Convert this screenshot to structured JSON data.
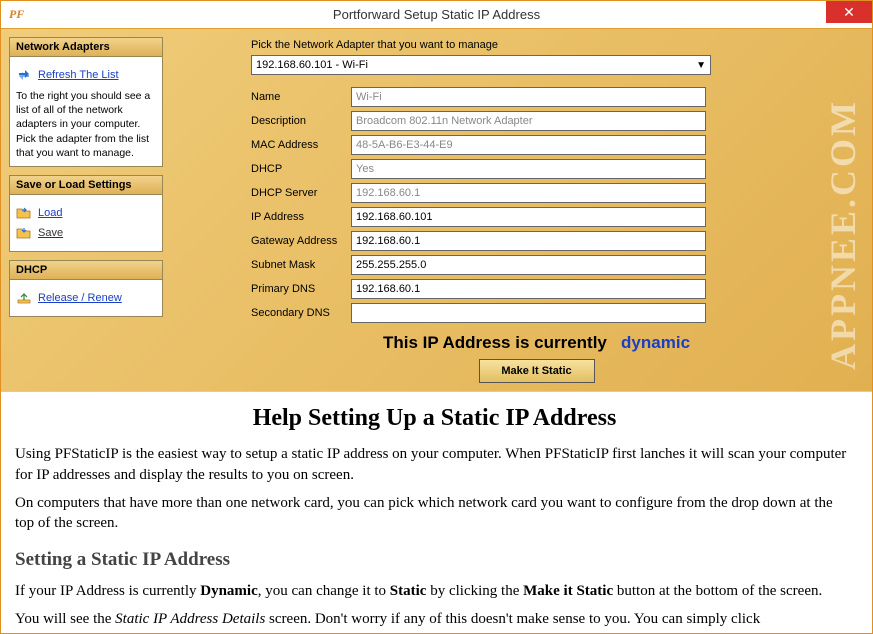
{
  "window": {
    "title": "Portforward Setup Static IP Address",
    "icon_label": "PF"
  },
  "sidebar": {
    "adapters": {
      "header": "Network Adapters",
      "refresh_link": "Refresh The List",
      "instructions": "To the right you should see a list of all of the network adapters in your computer. Pick the adapter from the list that you want to manage."
    },
    "saveload": {
      "header": "Save or Load Settings",
      "load_link": "Load",
      "save_link": "Save"
    },
    "dhcp": {
      "header": "DHCP",
      "release_link": "Release / Renew"
    }
  },
  "main": {
    "pick_label": "Pick the Network Adapter that you want to manage",
    "adapter_selected": "192.168.60.101 - Wi-Fi",
    "fields": {
      "name": {
        "label": "Name",
        "value": "Wi-Fi"
      },
      "description": {
        "label": "Description",
        "value": "Broadcom 802.11n Network Adapter"
      },
      "mac": {
        "label": "MAC Address",
        "value": "48-5A-B6-E3-44-E9"
      },
      "dhcp": {
        "label": "DHCP",
        "value": "Yes"
      },
      "dhcp_server": {
        "label": "DHCP Server",
        "value": "192.168.60.1"
      },
      "ip": {
        "label": "IP Address",
        "value": "192.168.60.101"
      },
      "gateway": {
        "label": "Gateway Address",
        "value": "192.168.60.1"
      },
      "subnet": {
        "label": "Subnet Mask",
        "value": "255.255.255.0"
      },
      "dns1": {
        "label": "Primary DNS",
        "value": "192.168.60.1"
      },
      "dns2": {
        "label": "Secondary DNS",
        "value": ""
      }
    },
    "status_prefix": "This IP Address is currently",
    "status_value": "dynamic",
    "make_static_btn": "Make It Static"
  },
  "help": {
    "h1": "Help Setting Up a Static IP Address",
    "p1": "Using PFStaticIP is the easiest way to setup a static IP address on your computer. When PFStaticIP first lanches it will scan your computer for IP addresses and display the results to you on screen.",
    "p2": "On computers that have more than one network card, you can pick which network card you want to configure from the drop down at the top of the screen.",
    "h2": "Setting a Static IP Address",
    "p3_a": "If your IP Address is currently ",
    "p3_b": "Dynamic",
    "p3_c": ", you can change it to ",
    "p3_d": "Static",
    "p3_e": " by clicking the ",
    "p3_f": "Make it Static",
    "p3_g": " button at the bottom of the screen.",
    "p4_a": "You will see the ",
    "p4_b": "Static IP Address Details",
    "p4_c": " screen. Don't worry if any of this doesn't make sense to you. You can simply click"
  },
  "watermark": "APPNEE.COM"
}
